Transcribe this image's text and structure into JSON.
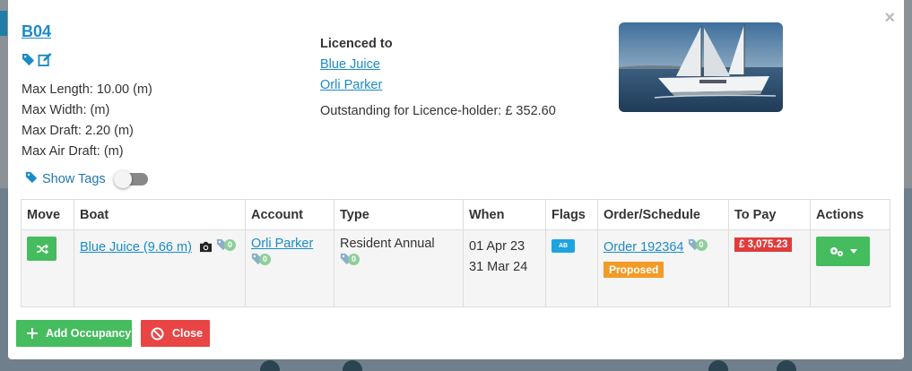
{
  "berth": {
    "title": "B04",
    "max_length": "Max Length: 10.00 (m)",
    "max_width": "Max Width: (m)",
    "max_draft": "Max Draft: 2.20 (m)",
    "max_air_draft": "Max Air Draft: (m)"
  },
  "show_tags_label": "Show Tags",
  "show_tags_on": false,
  "licence": {
    "heading": "Licenced to",
    "holders": [
      "Blue Juice",
      "Orli Parker"
    ],
    "outstanding": "Outstanding for Licence-holder: £ 352.60"
  },
  "photo": {
    "icon": "sailboat-photo"
  },
  "table": {
    "headers": [
      "Move",
      "Boat",
      "Account",
      "Type",
      "When",
      "Flags",
      "Order/Schedule",
      "To Pay",
      "Actions"
    ],
    "rows": [
      {
        "boat": "Blue Juice (9.66 m)",
        "boat_tag_count": "0",
        "account": "Orli Parker",
        "account_tag_count": "0",
        "type": "Resident Annual",
        "type_tag_count": "0",
        "when_from": "01 Apr 23",
        "when_to": "31 Mar 24",
        "flag": "AB",
        "order": "Order 192364",
        "order_tag_count": "0",
        "status": "Proposed",
        "to_pay": "£ 3,075.23"
      }
    ]
  },
  "footer": {
    "add_label": "Add Occupancy",
    "close_label": "Close"
  },
  "colors": {
    "green": "#45bc5e",
    "red": "#e94545",
    "link": "#1b8bc6",
    "orange": "#f29b26",
    "flag_blue": "#1ea4e0"
  }
}
